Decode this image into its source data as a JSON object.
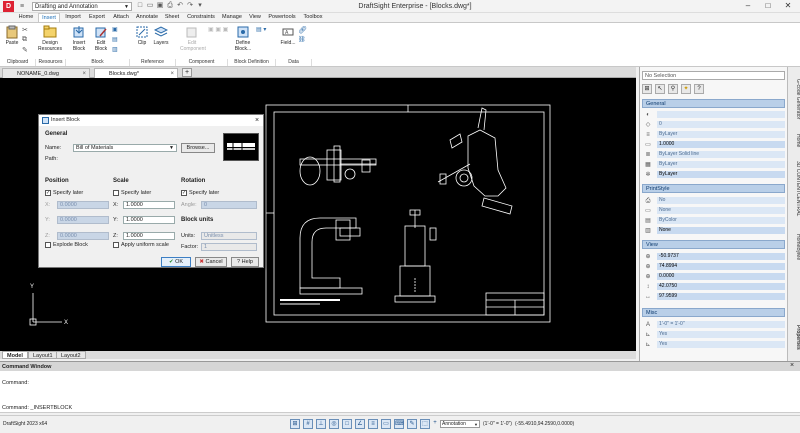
{
  "workspace": "Drafting and Annotation",
  "app_title": "DraftSight Enterprise - [Blocks.dwg*]",
  "ribbon_tabs": [
    "Home",
    "Insert",
    "Import",
    "Export",
    "Attach",
    "Annotate",
    "Sheet",
    "Constraints",
    "Manage",
    "View",
    "Powertools",
    "Toolbox"
  ],
  "ribbon": {
    "buttons": {
      "paste": "Paste",
      "design_resources": "Design Resources",
      "insert_block": "Insert Block",
      "edit_block": "Edit Block",
      "clip": "Clip",
      "layers": "Layers",
      "edit_component": "Edit Component",
      "define_block": "Define Block...",
      "field": "Field..."
    },
    "groups": [
      "Clipboard",
      "Resources",
      "Block",
      "Reference",
      "Component",
      "Block Definition",
      "Data"
    ]
  },
  "doc_tabs": [
    "NONAME_0.dwg",
    "Blocks.dwg*"
  ],
  "layout_tabs": [
    "Model",
    "Layout1",
    "Layout2"
  ],
  "command": {
    "header": "Command Window",
    "history": "Command:",
    "input": "Command: _INSERTBLOCK"
  },
  "status": {
    "version": "DraftSight 2023 x64",
    "annotation": "Annotation",
    "scale": "(1'-0\" = 1'-0\")",
    "coords": "(-55.4910,94.2590,0.0000)"
  },
  "dialog": {
    "title": "Insert Block",
    "general": "General",
    "name_label": "Name:",
    "name_value": "Bill of Materials",
    "browse": "Browse...",
    "path_label": "Path:",
    "position": "Position",
    "scale": "Scale",
    "rotation": "Rotation",
    "specify_later": "Specify later",
    "x": "X:",
    "y": "Y:",
    "z": "Z:",
    "pos_x": "0.0000",
    "pos_y": "0.0000",
    "pos_z": "0.0000",
    "scale_x": "1.0000",
    "scale_y": "1.0000",
    "scale_z": "1.0000",
    "angle_label": "Angle:",
    "angle_value": "0",
    "block_units": "Block units",
    "units_label": "Units:",
    "units_value": "Unitless",
    "factor_label": "Factor:",
    "factor_value": "1",
    "explode": "Explode Block",
    "uniform": "Apply uniform scale",
    "ok": "OK",
    "cancel": "Cancel",
    "help": "Help"
  },
  "properties": {
    "selection": "No Selection",
    "general_title": "General",
    "general_rows": [
      "",
      "0",
      "ByLayer",
      "1.0000",
      "ByLayer    Solid line",
      "ByLayer",
      "ByLayer"
    ],
    "printstyle_title": "PrintStyle",
    "printstyle_rows": [
      "No",
      "None",
      "ByColor",
      "None"
    ],
    "view_title": "View",
    "view_rows": [
      "-50.9737",
      "74.8994",
      "0.0000",
      "42.0750",
      "97.9599"
    ],
    "misc_title": "Misc",
    "misc_rows": [
      "1'-0\" = 1'-0\"",
      "Yes",
      "Yes"
    ],
    "side_tabs": [
      "G-code Generator",
      "Home",
      "3D CONTENTCENTRAL",
      "HomeByMe",
      "Properties"
    ]
  }
}
